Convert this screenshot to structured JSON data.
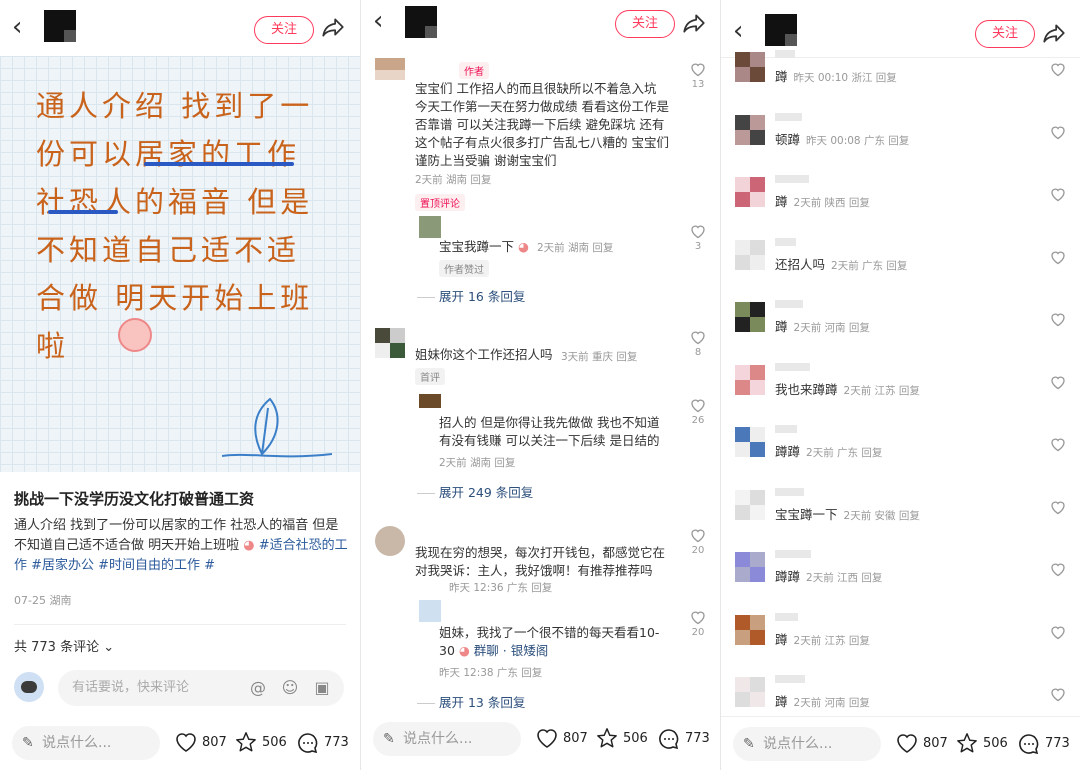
{
  "header": {
    "follow_label": "关注"
  },
  "post": {
    "image_text": "通人介绍 找到了一份可以居家的工作 社恐人的福音 但是不知道自己适不适合做 明天开始上班啦",
    "title": "挑战一下没学历没文化打破普通工资",
    "body": "通人介绍 找到了一份可以居家的工作  社恐人的福音 但是不知道自己适不适合做 明天开始上班啦",
    "tags": "#适合社恐的工作 #居家办公 #时间自由的工作 #",
    "date": "07-25 湖南",
    "comment_count": "共 773 条评论",
    "comment_placeholder": "有话要说，快来评论"
  },
  "bottom": {
    "say_placeholder": "说点什么...",
    "likes": "807",
    "stars": "506",
    "comments": "773"
  },
  "panel2": {
    "c1": {
      "badge": "作者",
      "text": "宝宝们 工作招人的而且很缺所以不着急入坑 今天工作第一天在努力做成绩 看看这份工作是否靠谱 可以关注我蹲一下后续 避免踩坑 还有这个帖子有点火很多打广告乱七八糟的 宝宝们谨防上当受骗 谢谢宝宝们",
      "meta": "2天前 湖南  回复",
      "likes": "13",
      "pin": "置顶评论"
    },
    "c1r": {
      "text": "宝宝我蹲一下",
      "meta": "2天前 湖南  回复",
      "badge": "作者赞过",
      "likes": "3"
    },
    "c1x": "展开 16 条回复",
    "c2": {
      "text": "姐妹你这个工作还招人吗",
      "meta": "3天前 重庆  回复",
      "badge": "首评",
      "likes": "8"
    },
    "c2r": {
      "text": "招人的 但是你得让我先做做 我也不知道有没有钱赚 可以关注一下后续 是日结的",
      "meta": "2天前 湖南  回复",
      "likes": "26"
    },
    "c2x": "展开 249 条回复",
    "c3": {
      "text": "我现在穷的想哭，每次打开钱包，都感觉它在对我哭诉：主人，我好饿啊！有推荐推荐吗",
      "meta": "昨天 12:36 广东  回复",
      "likes": "20"
    },
    "c3r": {
      "text": "姐妹，我找了一个很不错的每天看看10-30",
      "link": "群聊 · 银矮阁",
      "meta": "昨天 12:38 广东  回复",
      "likes": "20"
    },
    "c3x": "展开 13 条回复"
  },
  "panel3": {
    "rows": [
      {
        "text": "蹲",
        "meta": "昨天 00:10 浙江  回复"
      },
      {
        "text": "顿蹲",
        "meta": "昨天 00:08 广东  回复"
      },
      {
        "text": "蹲",
        "meta": "2天前 陕西  回复"
      },
      {
        "text": "还招人吗",
        "meta": "2天前 广东  回复"
      },
      {
        "text": "蹲",
        "meta": "2天前 河南  回复"
      },
      {
        "text": "我也来蹲蹲",
        "meta": "2天前 江苏  回复"
      },
      {
        "text": "蹲蹲",
        "meta": "2天前 广东  回复"
      },
      {
        "text": "宝宝蹲一下",
        "meta": "2天前 安徽  回复"
      },
      {
        "text": "蹲蹲",
        "meta": "2天前 江西  回复"
      },
      {
        "text": "蹲",
        "meta": "2天前 江苏  回复"
      },
      {
        "text": "蹲",
        "meta": "2天前 河南  回复"
      }
    ]
  },
  "icons": [
    "back-icon",
    "share-icon",
    "heart-icon",
    "star-icon",
    "comment-icon",
    "pen-icon",
    "at-icon",
    "emoji-icon",
    "image-icon"
  ],
  "colors": {
    "accent": "#ff3a5c",
    "handwriting": "#c9621a",
    "link": "#2c4f7c"
  }
}
